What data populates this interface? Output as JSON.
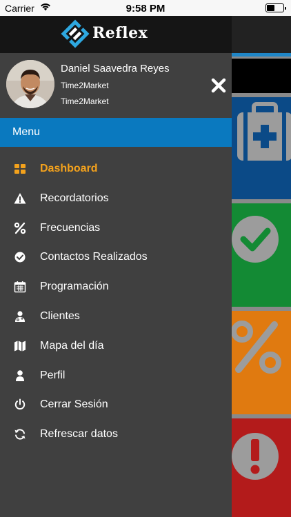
{
  "status_bar": {
    "carrier": "Carrier",
    "time": "9:58 PM"
  },
  "brand": {
    "name": "Reflex"
  },
  "user": {
    "name": "Daniel Saavedra Reyes",
    "company": "Time2Market",
    "subtitle": "Time2Market"
  },
  "menu": {
    "title": "Menu",
    "items": [
      {
        "label": "Dashboard",
        "icon": "dashboard-icon",
        "active": true
      },
      {
        "label": "Recordatorios",
        "icon": "warning-icon",
        "active": false
      },
      {
        "label": "Frecuencias",
        "icon": "percent-icon",
        "active": false
      },
      {
        "label": "Contactos Realizados",
        "icon": "check-circle-icon",
        "active": false
      },
      {
        "label": "Programación",
        "icon": "calendar-icon",
        "active": false
      },
      {
        "label": "Clientes",
        "icon": "user-md-icon",
        "active": false
      },
      {
        "label": "Mapa del día",
        "icon": "map-icon",
        "active": false
      },
      {
        "label": "Perfil",
        "icon": "user-icon",
        "active": false
      },
      {
        "label": "Cerrar Sesión",
        "icon": "power-icon",
        "active": false
      },
      {
        "label": "Refrescar datos",
        "icon": "refresh-icon",
        "active": false
      }
    ]
  },
  "colors": {
    "accent": "#f4a21c",
    "menu_bar": "#0a79bf",
    "drawer_bg": "#404040",
    "tile_blue": "#0b4a87",
    "tile_green": "#138a34",
    "tile_orange": "#e07a10",
    "tile_red": "#b31b1b"
  }
}
